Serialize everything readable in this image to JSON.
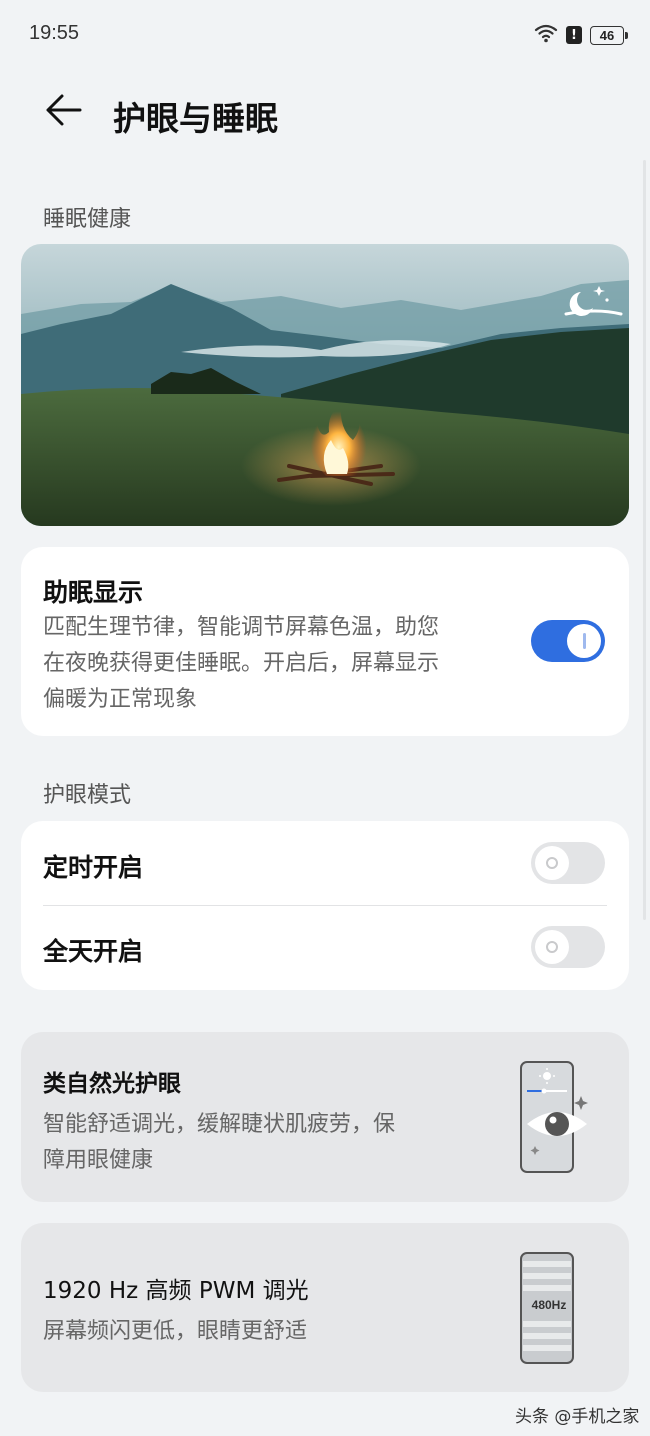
{
  "status_bar": {
    "time": "19:55",
    "battery": "46",
    "icons": [
      "wifi-icon",
      "alert-icon",
      "battery-icon"
    ]
  },
  "header": {
    "title": "护眼与睡眠",
    "back_icon": "back-arrow-icon"
  },
  "sleep_health": {
    "section_title": "睡眠健康",
    "hero_icon": "moon-stars-icon",
    "sleep_display": {
      "title": "助眠显示",
      "description_lines": [
        "匹配生理节律，智能调节屏幕色温，助您",
        "在夜晚获得更佳睡眠。开启后，屏幕显示",
        "偏暖为正常现象"
      ],
      "enabled": true
    }
  },
  "eye_care": {
    "section_title": "护眼模式",
    "items": [
      {
        "label": "定时开启",
        "enabled": false
      },
      {
        "label": "全天开启",
        "enabled": false
      }
    ]
  },
  "natural_light": {
    "title": "类自然光护眼",
    "description_lines": [
      "智能舒适调光，缓解睫状肌疲劳，保",
      "障用眼健康"
    ],
    "icon": "eye-phone-icon"
  },
  "pwm": {
    "title": "1920 Hz 高频 PWM 调光",
    "description": "屏幕频闪更低，眼睛更舒适",
    "icon_label": "480Hz"
  },
  "watermark": "头条 @手机之家",
  "colors": {
    "accent": "#2f6ee0",
    "background": "#f1f3f5",
    "card": "#ffffff",
    "card_gray": "#e6e7e9"
  }
}
